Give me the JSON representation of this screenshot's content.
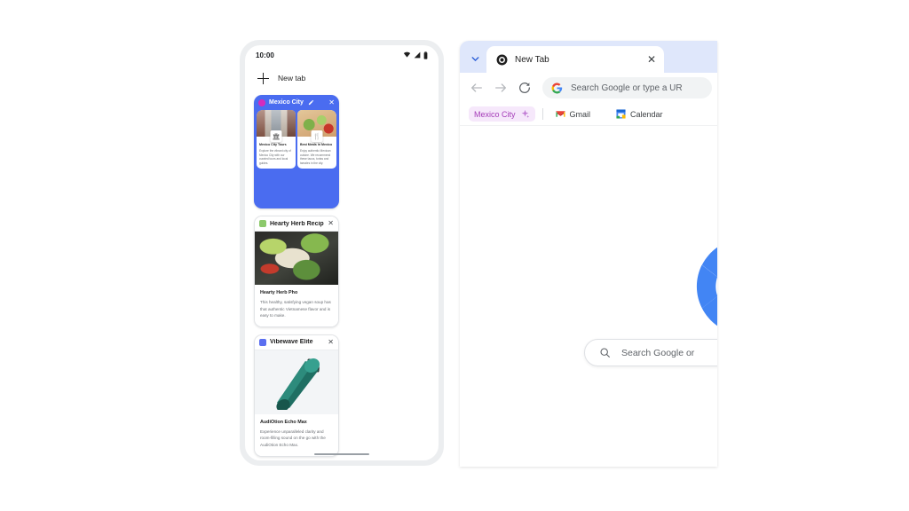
{
  "phone": {
    "status": {
      "time": "10:00",
      "icons": [
        "wifi-icon",
        "signal-icon",
        "battery-icon"
      ]
    },
    "new_tab_label": "New tab",
    "group_card": {
      "title": "Mexico City",
      "dot_color": "#d32bbd",
      "header_bg": "#4a6cf0",
      "edit_icon": "pencil-icon",
      "close_icon": "close-icon",
      "mini_tabs": [
        {
          "title": "Mexico City Tours",
          "desc": "Explore the vibrant city of Mexico City with our curated tours and local guides.",
          "badge": "landmark-icon"
        },
        {
          "title": "Best Meals in Mexico",
          "desc": "Enjoy authentic Mexican cuisine. We recommend these tacos, tortas and tamales in the city.",
          "badge": "restaurant-icon"
        }
      ]
    },
    "speaker_card": {
      "tab_title": "Vibewave Elite",
      "close_icon": "close-icon",
      "product_title": "AudiOtion Echo Max",
      "product_desc": "Experience unparalleled clarity and room-filling sound on the go with the AudiOtion Echo Max."
    },
    "recipe_card": {
      "tab_title": "Hearty Herb Recip",
      "close_icon": "close-icon",
      "recipe_title": "Hearty Herb Pho",
      "recipe_desc": "This healthy, satisfying vegan soup has that authentic Vietnamese flavor and is easy to make."
    }
  },
  "browser": {
    "tabstrip": {
      "chevron_icon": "chevron-down-icon",
      "tab": {
        "title": "New Tab",
        "favicon": "chrome-icon",
        "close_icon": "close-icon"
      }
    },
    "toolbar": {
      "back_icon": "arrow-back-icon",
      "forward_icon": "arrow-forward-icon",
      "reload_icon": "reload-icon",
      "omnibox": {
        "favicon": "google-g-icon",
        "text": "Search Google or type a UR"
      }
    },
    "bookmarks": [
      {
        "label": "Mexico City",
        "icon": "sparkle-icon",
        "highlight": true,
        "highlight_color": "#f6e8fb",
        "text_color": "#a43bb8"
      },
      {
        "label": "Gmail",
        "icon": "gmail-icon",
        "highlight": false
      },
      {
        "label": "Calendar",
        "icon": "calendar-icon",
        "highlight": false
      }
    ],
    "page": {
      "logo": "google-g-logo",
      "search_icon": "search-icon",
      "search_placeholder": "Search Google or "
    }
  }
}
